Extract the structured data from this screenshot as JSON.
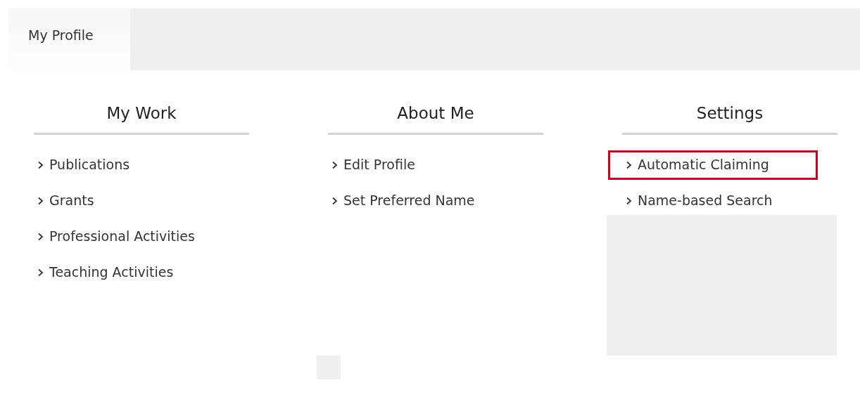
{
  "tabs": [
    {
      "label": "My Profile",
      "selected": true
    }
  ],
  "columns": [
    {
      "heading": "My Work",
      "links": [
        {
          "label": "Publications",
          "highlighted": false
        },
        {
          "label": "Grants",
          "highlighted": false
        },
        {
          "label": "Professional Activities",
          "highlighted": false
        },
        {
          "label": "Teaching Activities",
          "highlighted": false
        }
      ]
    },
    {
      "heading": "About Me",
      "links": [
        {
          "label": "Edit Profile",
          "highlighted": false
        },
        {
          "label": "Set Preferred Name",
          "highlighted": false
        }
      ]
    },
    {
      "heading": "Settings",
      "links": [
        {
          "label": "Automatic Claiming",
          "highlighted": true
        },
        {
          "label": "Name-based Search",
          "highlighted": false
        }
      ]
    }
  ]
}
